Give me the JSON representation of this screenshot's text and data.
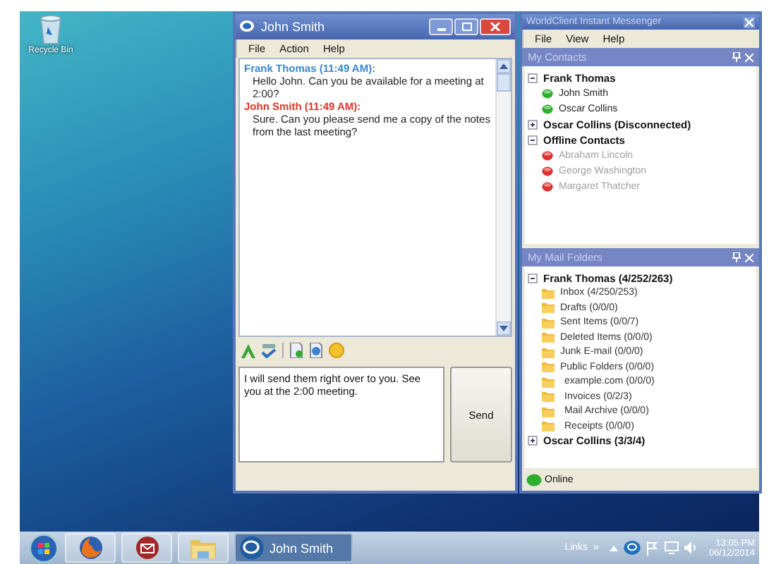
{
  "desktop": {
    "icons": [
      {
        "label": "Recycle Bin"
      }
    ]
  },
  "chat_window": {
    "title": "John Smith",
    "menu": [
      "File",
      "Action",
      "Help"
    ],
    "messages": [
      {
        "kind": "remote",
        "sender": "Frank Thomas (11:49 AM):",
        "text": "Hello John. Can you be available for a meeting at 2:00?"
      },
      {
        "kind": "local",
        "sender": "John Smith (11:49 AM):",
        "text": "Sure. Can you please send me a copy of the notes from the last meeting?"
      }
    ],
    "compose": {
      "value": "I will send them right over to you. See you at the 2:00 meeting."
    },
    "send_button": "Send"
  },
  "messenger": {
    "title": "WorldClient Instant Messenger",
    "menu": [
      "File",
      "View",
      "Help"
    ],
    "contacts_panel": {
      "title": "My Contacts",
      "groups": [
        {
          "name": "Frank Thomas",
          "expanded": true,
          "children": [
            {
              "name": "John Smith",
              "online": true
            },
            {
              "name": "Oscar Collins",
              "online": true
            }
          ]
        },
        {
          "name": "Oscar Collins (Disconnected)",
          "expanded": false
        },
        {
          "name": "Offline Contacts",
          "expanded": true,
          "children": [
            {
              "name": "Abraham Lincoln",
              "online": false
            },
            {
              "name": "George Washington",
              "online": false
            },
            {
              "name": "Margaret Thatcher",
              "online": false
            }
          ]
        }
      ]
    },
    "mail_panel": {
      "title": "My Mail Folders",
      "accounts": [
        {
          "name": "Frank Thomas (4/252/263)",
          "expanded": true,
          "children": [
            {
              "name": "Inbox (4/250/253)"
            },
            {
              "name": "Drafts (0/0/0)"
            },
            {
              "name": "Sent Items (0/0/7)"
            },
            {
              "name": "Deleted Items (0/0/0)"
            },
            {
              "name": "Junk E-mail (0/0/0)"
            },
            {
              "name": "Public Folders (0/0/0)",
              "children": [
                {
                  "name": "example.com (0/0/0)"
                },
                {
                  "name": "Invoices (0/2/3)"
                },
                {
                  "name": "Mail Archive (0/0/0)"
                },
                {
                  "name": "Receipts (0/0/0)"
                }
              ]
            }
          ]
        },
        {
          "name": "Oscar Collins (3/3/4)",
          "expanded": false
        }
      ]
    },
    "status": "Online"
  },
  "taskbar": {
    "task": "John Smith",
    "links": "Links",
    "overflow": "»",
    "time": "13:05 PM",
    "date": "06/12/2014"
  }
}
